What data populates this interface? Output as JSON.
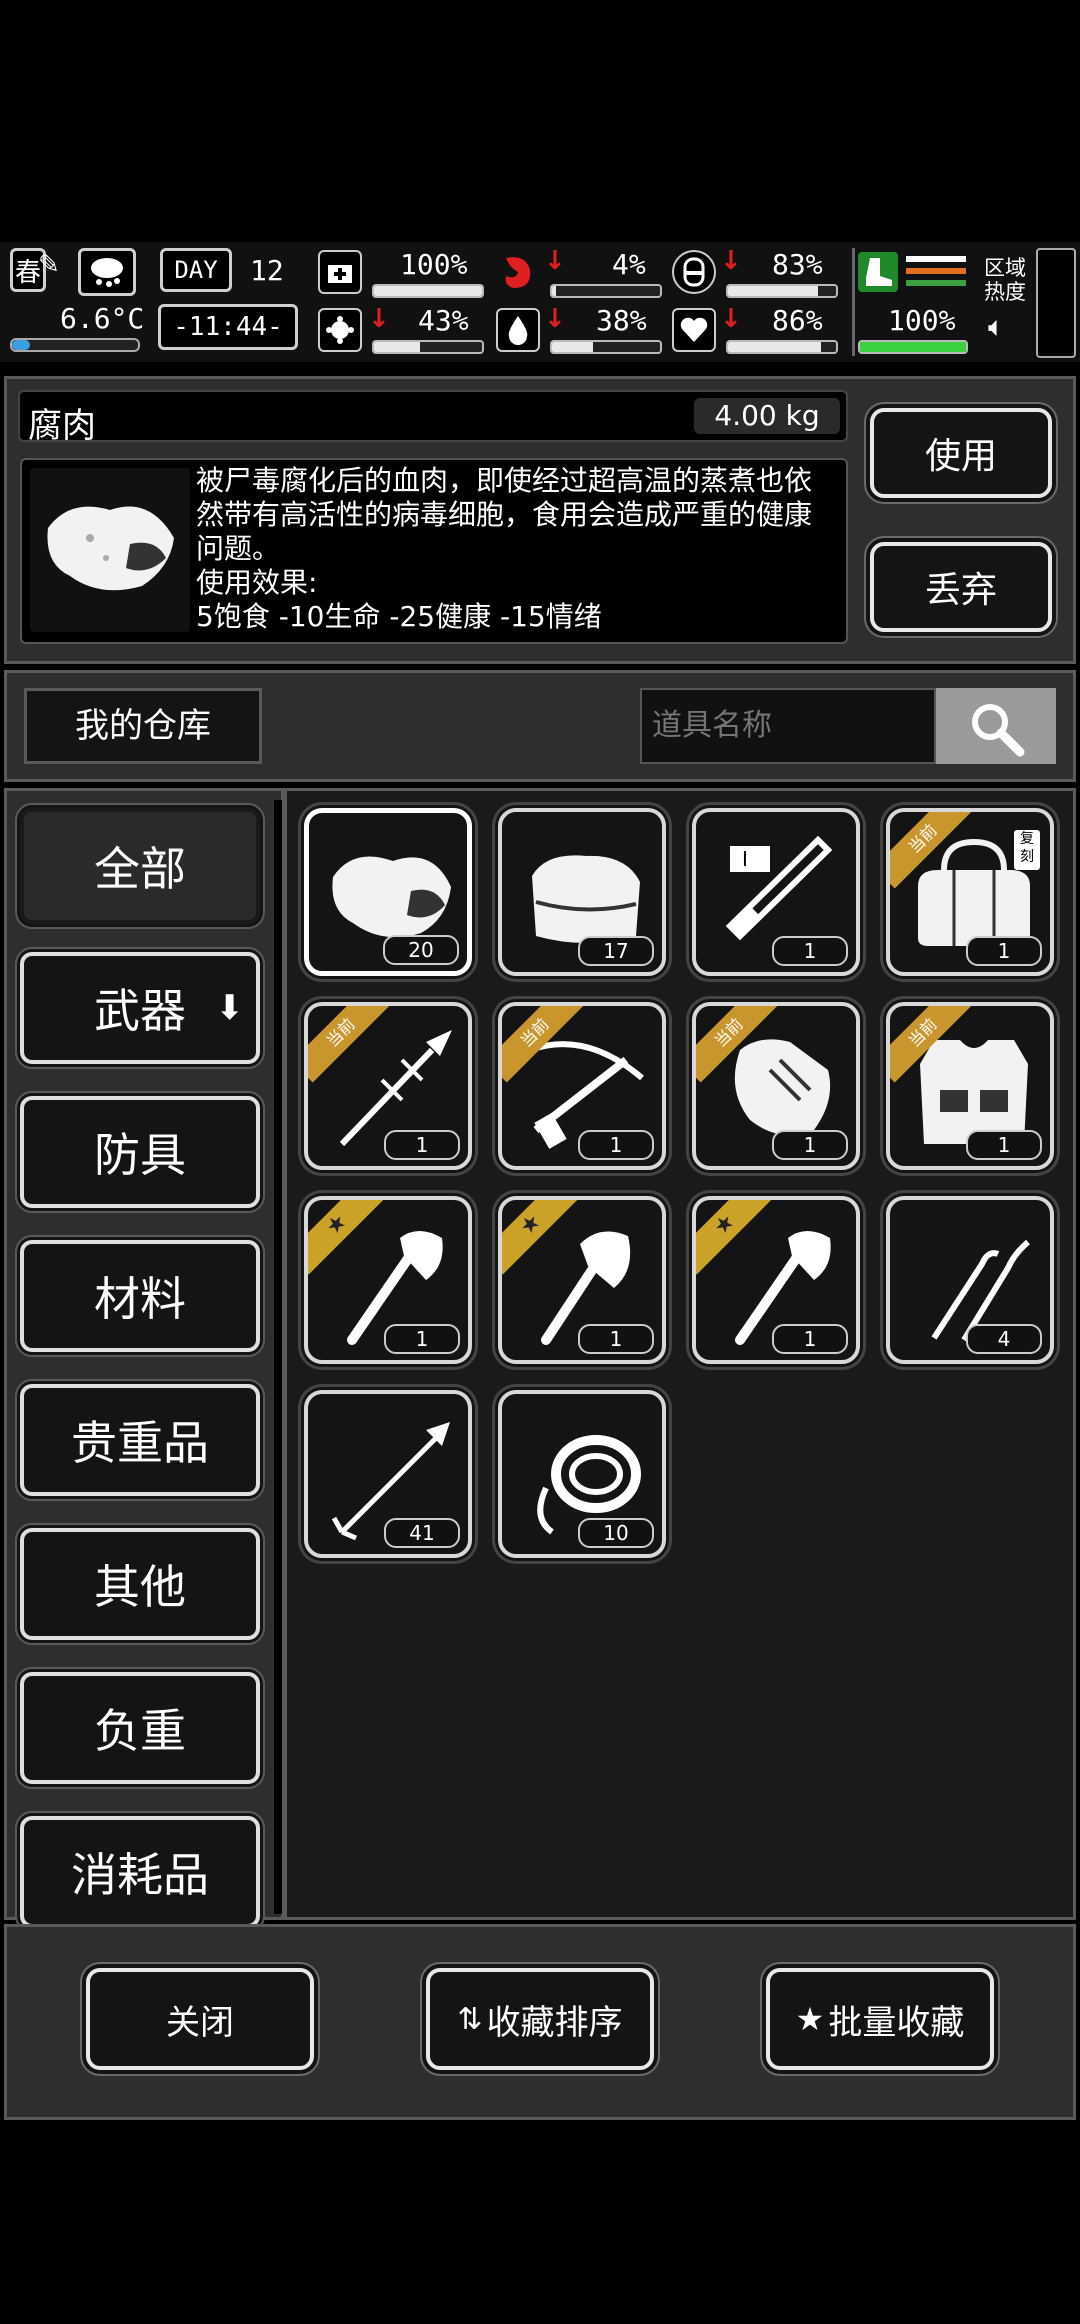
{
  "status": {
    "season": "春",
    "temperature": "6.6°C",
    "day_label": "DAY",
    "day_number": "12",
    "clock": "-11:44-",
    "stats": [
      {
        "name": "health",
        "value": "100%",
        "level": 1.0
      },
      {
        "name": "infection",
        "value": "43%",
        "level": 0.43
      },
      {
        "name": "hunger",
        "value": "4%",
        "level": 0.04
      },
      {
        "name": "thirst",
        "value": "38%",
        "level": 0.38
      },
      {
        "name": "stamina",
        "value": "83%",
        "level": 0.83
      },
      {
        "name": "mood",
        "value": "86%",
        "level": 0.86
      },
      {
        "name": "endurance",
        "value": "100%",
        "level": 1.0
      }
    ],
    "region_heat_label": "区域\n热度"
  },
  "item": {
    "name": "腐肉",
    "weight": "4.00 kg",
    "description": "被尸毒腐化后的血肉，即使经过超高温的蒸煮也依然带有高活性的病毒细胞，食用会造成严重的健康问题。",
    "effect_label": "使用效果:",
    "effect_text": "5饱食 -10生命 -25健康 -15情绪",
    "use_label": "使用",
    "discard_label": "丢弃"
  },
  "storage": {
    "title": "我的仓库",
    "search_placeholder": "道具名称"
  },
  "categories": [
    "全部",
    "武器",
    "防具",
    "材料",
    "贵重品",
    "其他",
    "负重",
    "消耗品"
  ],
  "items": [
    {
      "icon": "rotten-meat-icon",
      "count": "20",
      "badge": ""
    },
    {
      "icon": "cloth-icon",
      "count": "17",
      "badge": ""
    },
    {
      "icon": "syringe-icon",
      "count": "1",
      "badge": ""
    },
    {
      "icon": "duffel-bag-icon",
      "count": "1",
      "badge": "当前",
      "tag": "复刻"
    },
    {
      "icon": "spear-icon",
      "count": "1",
      "badge": "当前"
    },
    {
      "icon": "crossbow-icon",
      "count": "1",
      "badge": "当前"
    },
    {
      "icon": "gloves-icon",
      "count": "1",
      "badge": "当前"
    },
    {
      "icon": "vest-icon",
      "count": "1",
      "badge": "当前"
    },
    {
      "icon": "axe-icon",
      "count": "1",
      "badge": "★"
    },
    {
      "icon": "hatchet-icon",
      "count": "1",
      "badge": "★"
    },
    {
      "icon": "axe-icon",
      "count": "1",
      "badge": "★"
    },
    {
      "icon": "lockpick-icon",
      "count": "4",
      "badge": ""
    },
    {
      "icon": "arrow-icon",
      "count": "41",
      "badge": ""
    },
    {
      "icon": "rope-icon",
      "count": "10",
      "badge": ""
    }
  ],
  "footer": {
    "close_label": "关闭",
    "sort_label": "收藏排序",
    "batch_label": "批量收藏"
  }
}
